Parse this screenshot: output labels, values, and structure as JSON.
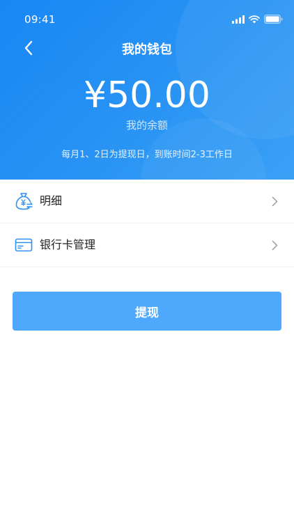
{
  "status_bar": {
    "time": "09:41"
  },
  "nav": {
    "back_icon": "chevron-left-icon",
    "title": "我的钱包"
  },
  "balance": {
    "amount": "¥50.00",
    "label": "我的余额"
  },
  "notice": "每月1、2日为提现日，到账时间2-3工作日",
  "menu": {
    "items": [
      {
        "label": "明细",
        "icon": "money-bag-icon"
      },
      {
        "label": "银行卡管理",
        "icon": "bank-card-icon"
      }
    ]
  },
  "withdraw": {
    "label": "提现"
  },
  "colors": {
    "header_start": "#1886f5",
    "header_end": "#3aa0f6",
    "button": "#4ea8fb",
    "icon_blue": "#2e8ff5",
    "divider": "#f0f0f0",
    "text_dark": "#222222"
  }
}
